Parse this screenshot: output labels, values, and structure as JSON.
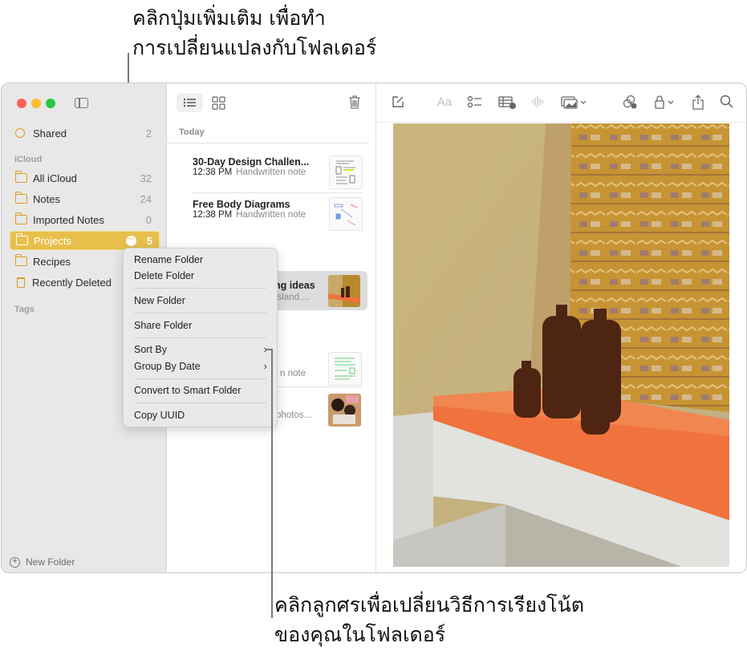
{
  "callouts": {
    "top_line1": "คลิกปุ่มเพิ่มเติม เพื่อทำ",
    "top_line2": "การเปลี่ยนแปลงกับโฟลเดอร์",
    "bottom_line1": "คลิกลูกศรเพื่อเปลี่ยนวิธีการเรียงโน้ต",
    "bottom_line2": "ของคุณในโฟลเดอร์"
  },
  "window": {
    "traffic_lights": {
      "close": "#fe5f57",
      "minimize": "#febc2e",
      "zoom": "#28c840"
    }
  },
  "sidebar": {
    "shared": {
      "label": "Shared",
      "count": "2"
    },
    "icloud_header": "iCloud",
    "folders": [
      {
        "label": "All iCloud",
        "count": "32"
      },
      {
        "label": "Notes",
        "count": "24"
      },
      {
        "label": "Imported Notes",
        "count": "0"
      },
      {
        "label": "Projects",
        "count": "5",
        "selected": true
      },
      {
        "label": "Recipes",
        "count": ""
      },
      {
        "label": "Recently Deleted",
        "count": ""
      }
    ],
    "tags_header": "Tags",
    "new_folder": "New Folder",
    "accent": "#e8bf4a"
  },
  "note_list": {
    "section": "Today",
    "notes": [
      {
        "title": "30-Day Design Challen...",
        "time": "12:38 PM",
        "subtitle": "Handwritten note"
      },
      {
        "title": "Free Body Diagrams",
        "time": "12:38 PM",
        "subtitle": "Handwritten note"
      },
      {
        "title": "ng ideas",
        "subtitle": "island...."
      },
      {
        "title": "",
        "subtitle": "n note"
      },
      {
        "title": "",
        "subtitle": "photos..."
      }
    ]
  },
  "toolbar": {
    "icons": [
      "compose-icon",
      "format-icon",
      "checklist-icon",
      "table-icon",
      "audio-icon",
      "media-icon",
      "collaborate-icon",
      "lock-icon",
      "share-icon",
      "search-icon"
    ],
    "format_label": "Aa"
  },
  "context_menu": {
    "items": [
      {
        "label": "Rename Folder"
      },
      {
        "label": "Delete Folder"
      },
      {
        "label": "New Folder"
      },
      {
        "label": "Share Folder"
      },
      {
        "label": "Sort By",
        "submenu": true
      },
      {
        "label": "Group By Date",
        "submenu": true
      },
      {
        "label": "Convert to Smart Folder"
      },
      {
        "label": "Copy UUID"
      }
    ],
    "chevron": "›"
  }
}
